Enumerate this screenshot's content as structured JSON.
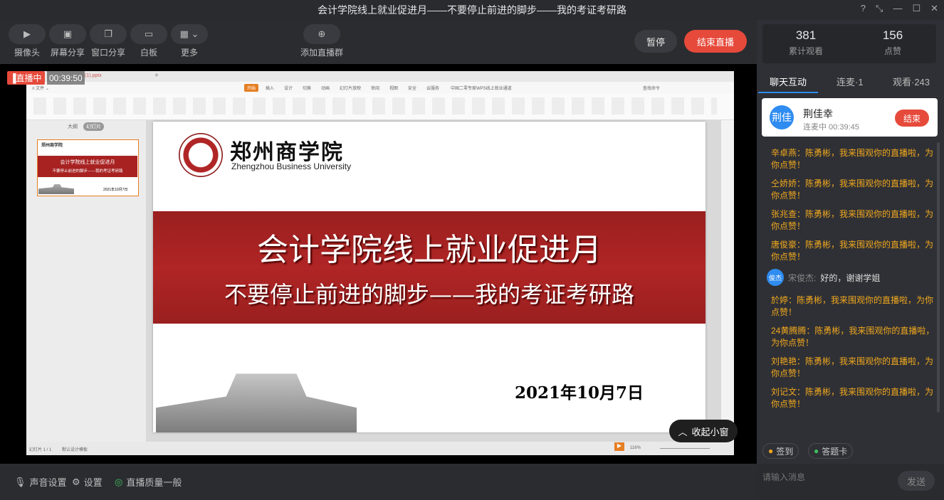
{
  "window": {
    "title": "会计学院线上就业促进月——不要停止前进的脚步——我的考证考研路"
  },
  "toolbar": {
    "camera": "摄像头",
    "screen_share": "屏幕分享",
    "window_share": "窗口分享",
    "whiteboard": "白板",
    "more": "更多",
    "add_group": "添加直播群",
    "pause": "暂停",
    "end_live": "结束直播"
  },
  "live": {
    "badge": "直播中",
    "elapsed": "00:39:50",
    "collapse": "收起小窗"
  },
  "wps": {
    "file_name": "(1).pptx",
    "ribbon_tabs": [
      "开始",
      "插入",
      "设计",
      "切换",
      "动画",
      "幻灯片放映",
      "审阅",
      "视图",
      "安全",
      "云服务"
    ],
    "doc_title": "中国二零专家WPS线上就业通道",
    "search": "查找命令",
    "thumb_tabs": [
      "大纲",
      "幻灯片"
    ],
    "thumb_title": "会计学院线上就业促进月",
    "thumb_sub": "不要停止前进的脚步——我的考证考研路",
    "thumb_date": "2021年10月7日",
    "status_left": "幻灯片 1 / 1",
    "status_theme": "默认设计模板",
    "zoom": "116%"
  },
  "slide": {
    "school_cn": "郑州商学院",
    "school_en": "Zhengzhou Business University",
    "title": "会计学院线上就业促进月",
    "subtitle": "不要停止前进的脚步——我的考证考研路",
    "date": "2021年10月7日"
  },
  "bottom": {
    "audio": "声音设置",
    "settings": "设置",
    "quality": "直播质量一般"
  },
  "sidebar": {
    "stats": [
      {
        "num": "381",
        "label": "累计观看"
      },
      {
        "num": "156",
        "label": "点赞"
      }
    ],
    "tabs": [
      "聊天互动",
      "连麦·1",
      "观看·243"
    ],
    "link_user": {
      "avatar": "荆佳",
      "name": "荆佳幸",
      "status": "连麦中 00:39:45",
      "end": "结束"
    },
    "messages": [
      "辛卓燕：陈勇彬，我来围观你的直播啦，为你点赞！",
      "仝娇娇：陈勇彬，我来围观你的直播啦，为你点赞！",
      "张兆查：陈勇彬，我来围观你的直播啦，为你点赞！",
      "唐俊豪：陈勇彬，我来围观你的直播啦，为你点赞！",
      "於婷：陈勇彬，我来围观你的直播啦，为你点赞！",
      "24黄腾腾：陈勇彬，我来围观你的直播啦，为你点赞！",
      "刘艳艳：陈勇彬，我来围观你的直播啦，为你点赞！",
      "刘记文：陈勇彬，我来围观你的直播啦，为你点赞！"
    ],
    "reply": {
      "avatar": "俊杰",
      "name": "宋俊杰:",
      "text": "好的，谢谢学姐"
    },
    "checkin": "签到",
    "answer_card": "答题卡",
    "input_placeholder": "请输入消息",
    "send": "发送"
  },
  "colors": {
    "accent_red": "#e64a3b",
    "chat_orange": "#f0a81e",
    "tab_active": "#2f8cf0"
  }
}
